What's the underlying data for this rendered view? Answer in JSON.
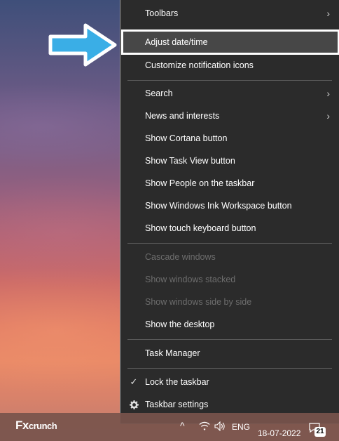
{
  "menu": {
    "toolbars": "Toolbars",
    "adjust_datetime": "Adjust date/time",
    "customize_notification": "Customize notification icons",
    "search": "Search",
    "news": "News and interests",
    "cortana": "Show Cortana button",
    "task_view": "Show Task View button",
    "people": "Show People on the taskbar",
    "ink": "Show Windows Ink Workspace button",
    "touch_keyboard": "Show touch keyboard button",
    "cascade": "Cascade windows",
    "stacked": "Show windows stacked",
    "side_by_side": "Show windows side by side",
    "show_desktop": "Show the desktop",
    "task_manager": "Task Manager",
    "lock_taskbar": "Lock the taskbar",
    "taskbar_settings": "Taskbar settings"
  },
  "taskbar": {
    "brand_fx": "Fx",
    "brand_crunch": "crunch",
    "language": "ENG",
    "date": "18-07-2022",
    "notification_count": "21"
  },
  "icons": {
    "submenu": "chevron-right-icon",
    "check": "checkmark-icon",
    "settings": "gear-icon",
    "arrow": "pointer-arrow-icon"
  },
  "colors": {
    "menu_bg": "#2b2b2b",
    "highlight_bg": "#474747",
    "arrow_fill": "#3aaee6"
  }
}
